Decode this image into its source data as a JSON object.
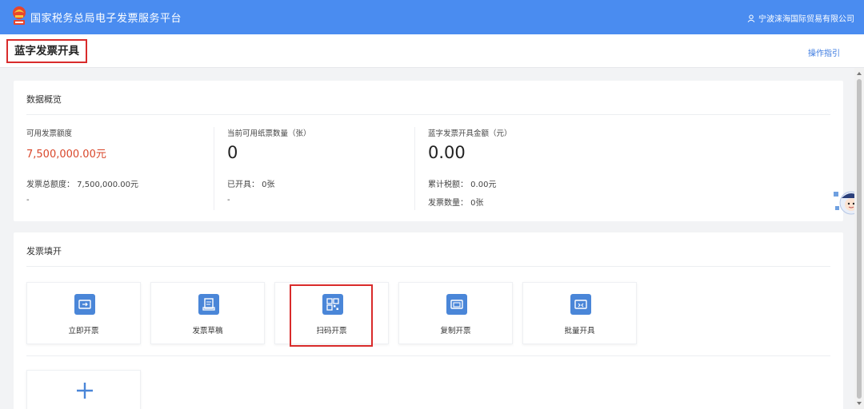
{
  "header": {
    "app_title": "国家税务总局电子发票服务平台",
    "user_name": "宁波涞海国际贸易有限公司",
    "brand_color": "#4a8cf0"
  },
  "page": {
    "title": "蓝字发票开具",
    "guide_link": "操作指引"
  },
  "overview": {
    "title": "数据概览",
    "stats": [
      {
        "label": "可用发票额度",
        "value": "7,500,000.00元",
        "sub1": "发票总额度： 7,500,000.00元",
        "sub2": "-"
      },
      {
        "label": "当前可用纸票数量（张）",
        "value": "0",
        "sub1": "已开具： 0张",
        "sub2": "-"
      },
      {
        "label": "蓝字发票开具金额（元）",
        "value": "0.00",
        "sub1": "累计税额： 0.00元",
        "sub2": "发票数量： 0张"
      }
    ]
  },
  "issue": {
    "title": "发票填开",
    "tiles": [
      {
        "label": "立即开票",
        "icon": "instant-invoice-icon"
      },
      {
        "label": "发票草稿",
        "icon": "draft-icon"
      },
      {
        "label": "扫码开票",
        "icon": "qr-code-icon"
      },
      {
        "label": "复制开票",
        "icon": "copy-invoice-icon"
      },
      {
        "label": "批量开具",
        "icon": "batch-issue-icon"
      }
    ],
    "add_icon": "plus-icon",
    "highlight_color": "#d92b2b"
  },
  "colors": {
    "accent_red": "#d9472b",
    "tile_icon_bg": "#4a86d8",
    "link_blue": "#3d7be0"
  }
}
